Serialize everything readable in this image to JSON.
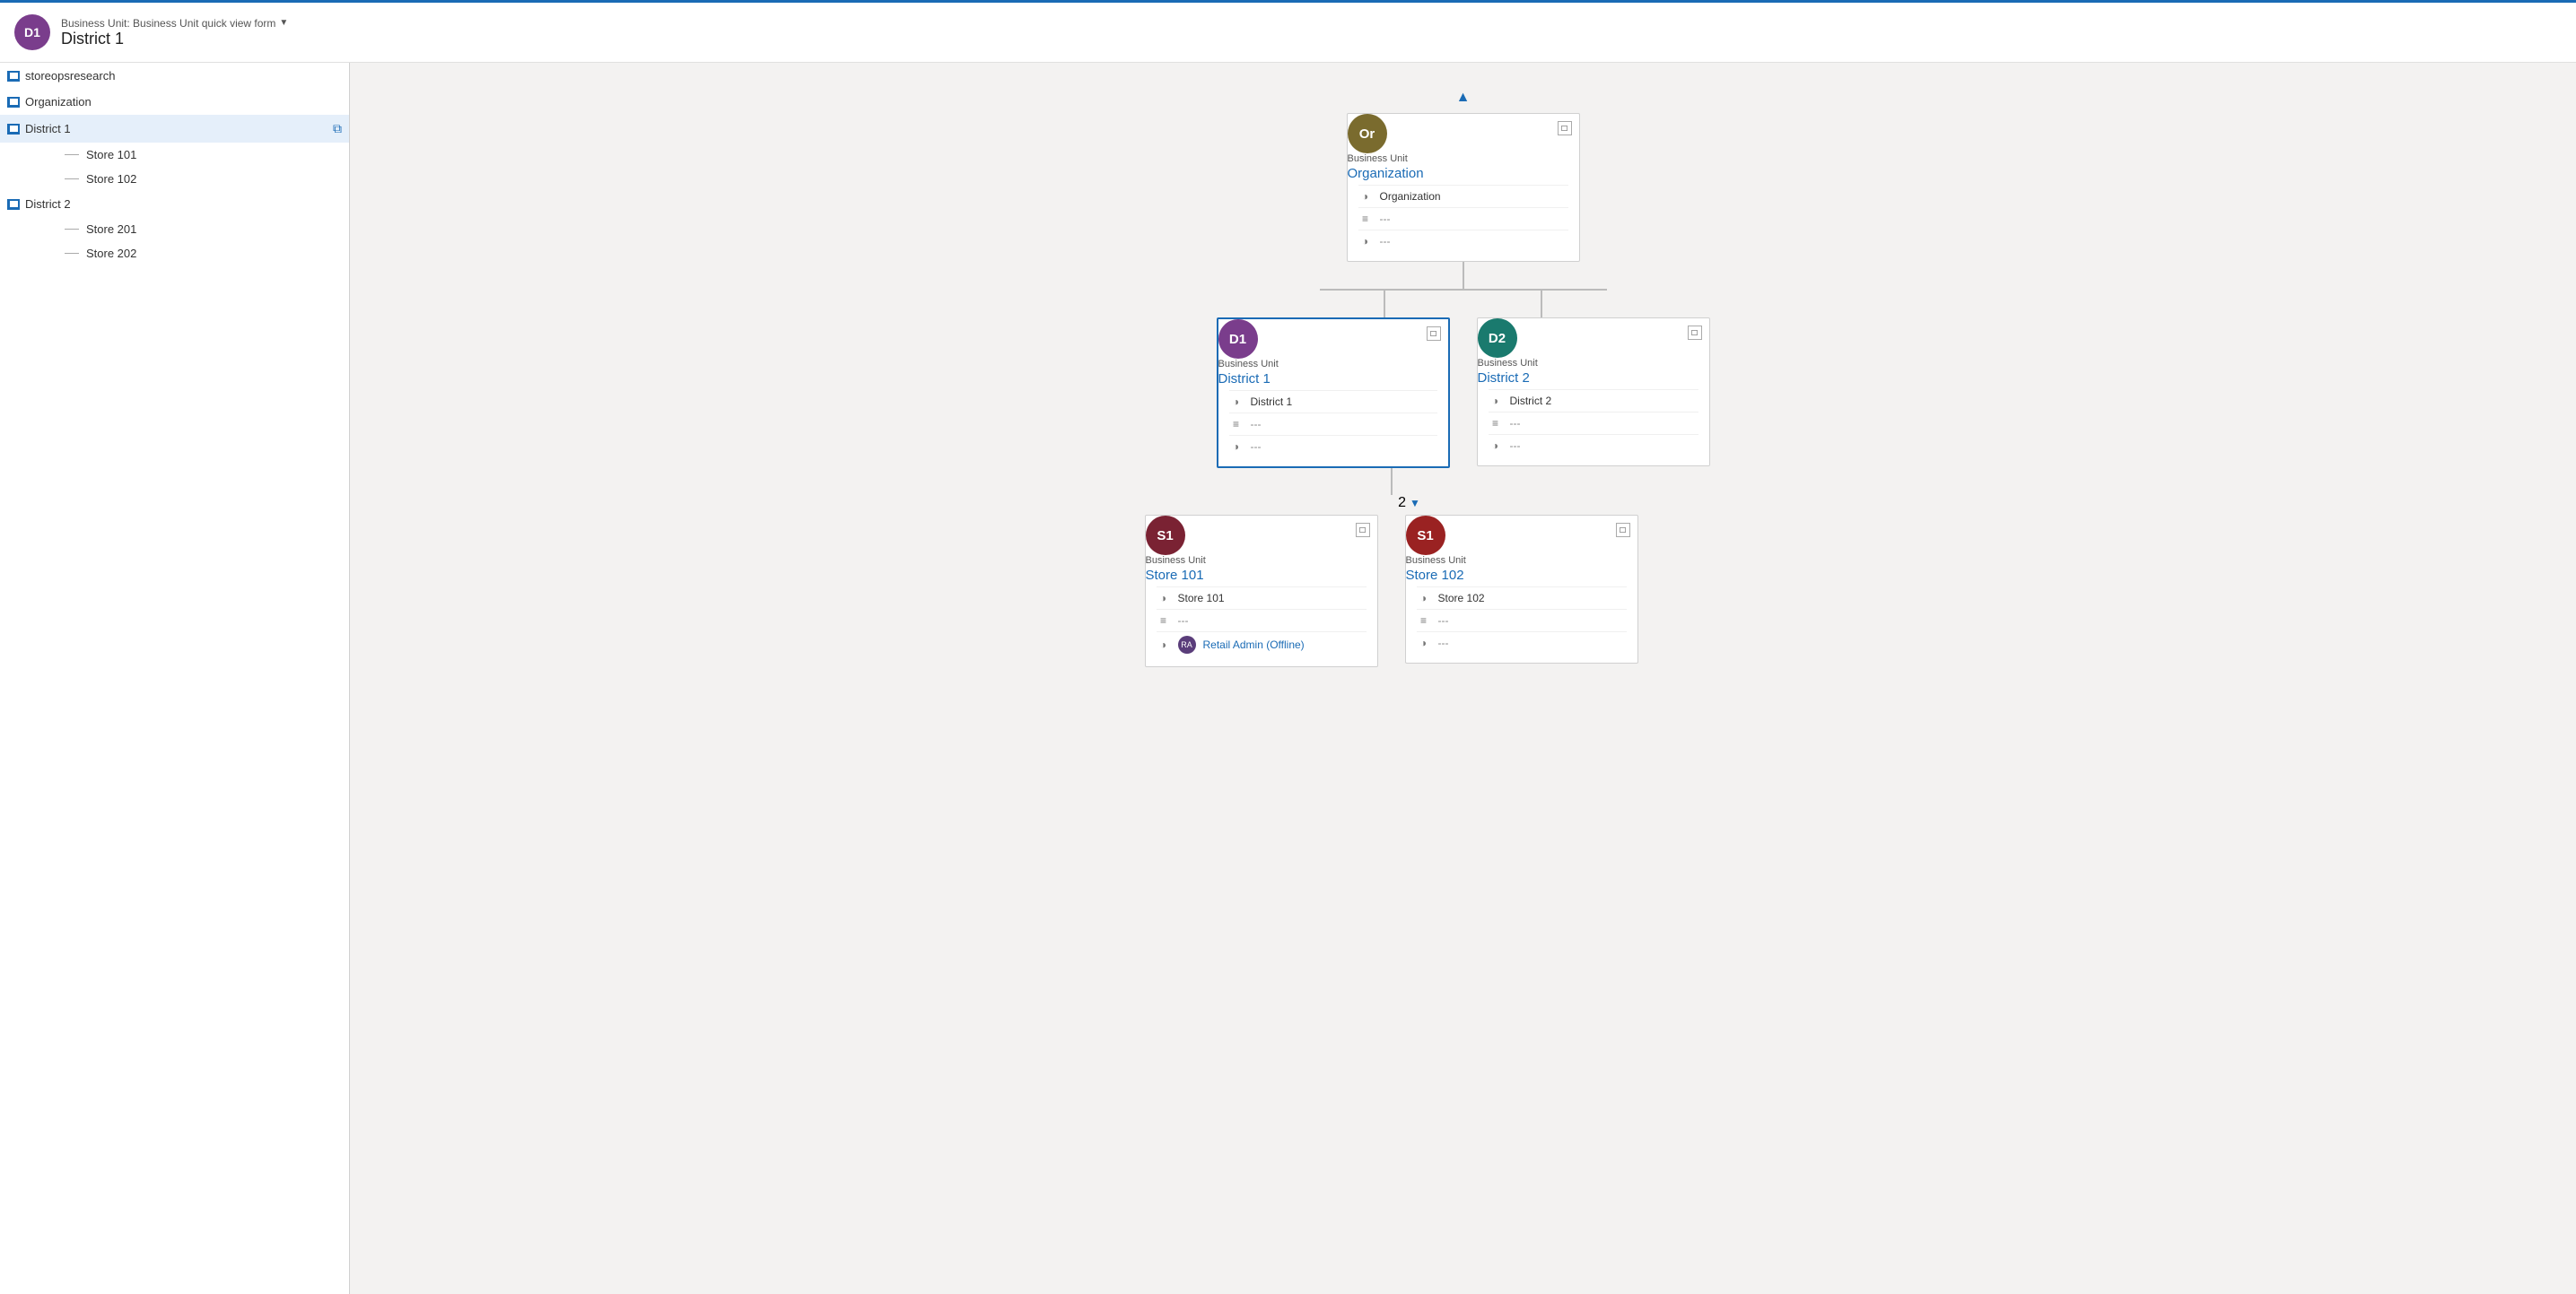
{
  "header": {
    "avatar_initials": "D1",
    "subtitle": "Business Unit: Business Unit quick view form",
    "title": "District 1"
  },
  "sidebar": {
    "root": "storeopsresearch",
    "items": [
      {
        "label": "Organization",
        "level": 1,
        "type": "folder",
        "active": false
      },
      {
        "label": "District 1",
        "level": 2,
        "type": "folder",
        "active": true
      },
      {
        "label": "Store 101",
        "level": 3,
        "type": "leaf"
      },
      {
        "label": "Store 102",
        "level": 3,
        "type": "leaf"
      },
      {
        "label": "District 2",
        "level": 2,
        "type": "folder",
        "active": false
      },
      {
        "label": "Store 201",
        "level": 3,
        "type": "leaf"
      },
      {
        "label": "Store 202",
        "level": 3,
        "type": "leaf"
      }
    ]
  },
  "chart": {
    "nav_up_title": "Navigate up",
    "org_card": {
      "avatar_initials": "Or",
      "avatar_color": "olive",
      "type_label": "Business Unit",
      "name": "Organization",
      "field1": "Organization",
      "field2": "---",
      "field3": "---"
    },
    "district1_card": {
      "avatar_initials": "D1",
      "avatar_color": "purple",
      "type_label": "Business Unit",
      "name": "District 1",
      "field1": "District 1",
      "field2": "---",
      "field3": "---",
      "selected": true
    },
    "district2_card": {
      "avatar_initials": "D2",
      "avatar_color": "teal",
      "type_label": "Business Unit",
      "name": "District 2",
      "field1": "District 2",
      "field2": "---",
      "field3": "---",
      "selected": false
    },
    "count_badge": "2",
    "store101_card": {
      "avatar_initials": "S1",
      "avatar_color": "maroon",
      "type_label": "Business Unit",
      "name": "Store 101",
      "field1": "Store 101",
      "field2": "---",
      "field3_label": "RA",
      "field3_value": "Retail Admin (Offline)"
    },
    "store102_card": {
      "avatar_initials": "S1",
      "avatar_color": "darkred",
      "type_label": "Business Unit",
      "name": "Store 102",
      "field1": "Store 102",
      "field2": "---",
      "field3": "---"
    }
  },
  "icons": {
    "collapse": "▲",
    "expand_card": "□",
    "field_org": "◑",
    "field_list": "≡",
    "field_link": "◑",
    "external_link": "⧉",
    "dropdown_arrow": "▼"
  }
}
